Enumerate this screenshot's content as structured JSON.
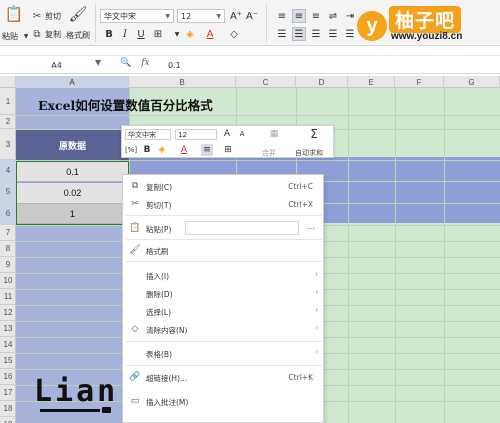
{
  "ribbon": {
    "paste_label": "粘贴",
    "cut_label": "剪切",
    "copy_label": "复制",
    "format_painter_label": "格式刷",
    "font_name": "华文中宋",
    "font_size": "12",
    "grow_font": "A⁺",
    "shrink_font": "A⁻"
  },
  "watermark": {
    "logo_letter": "y",
    "site_title": "柚子吧",
    "site_url": "www.youzi8.cn",
    "signature": "Lian"
  },
  "formula_bar": {
    "cell_ref": "A4",
    "fx": "fx",
    "value": "0.1"
  },
  "grid": {
    "columns": [
      "A",
      "B",
      "C",
      "D",
      "E",
      "F",
      "G"
    ],
    "rows": [
      "1",
      "2",
      "3",
      "4",
      "5",
      "6",
      "7",
      "8",
      "9",
      "10",
      "11",
      "12",
      "13",
      "14",
      "15",
      "16",
      "17",
      "18",
      "19"
    ],
    "title": "Excel如何设置数值百分比格式",
    "header": "原数据",
    "values": [
      "0.1",
      "0.02",
      "1"
    ]
  },
  "mini_toolbar": {
    "font_name": "华文中宋",
    "font_size": "12",
    "merge_label": "合并",
    "autosum_label": "自动求和"
  },
  "context_menu": {
    "items": [
      {
        "label": "复制(C)",
        "shortcut": "Ctrl+C",
        "icon": "copy-icon"
      },
      {
        "label": "剪切(T)",
        "shortcut": "Ctrl+X",
        "icon": "scissors-icon"
      },
      {
        "label": "粘贴(P)",
        "shortcut": "",
        "icon": "paste-icon"
      },
      {
        "label": "格式刷",
        "shortcut": "",
        "icon": "brush-icon"
      },
      {
        "label": "插入(I)",
        "shortcut": "",
        "icon": ""
      },
      {
        "label": "删除(D)",
        "shortcut": "",
        "icon": ""
      },
      {
        "label": "选择(L)",
        "shortcut": "",
        "icon": ""
      },
      {
        "label": "清除内容(N)",
        "shortcut": "",
        "icon": "eraser-icon"
      },
      {
        "label": "表格(B)",
        "shortcut": "",
        "icon": ""
      },
      {
        "label": "超链接(H)...",
        "shortcut": "Ctrl+K",
        "icon": "link-icon"
      },
      {
        "label": "插入批注(M)",
        "shortcut": "",
        "icon": "comment-icon"
      }
    ],
    "paste_more": "..."
  }
}
